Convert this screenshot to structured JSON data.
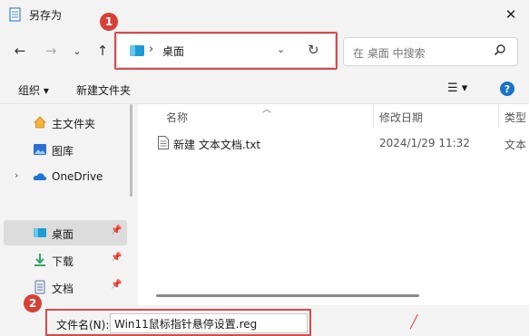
{
  "window": {
    "title": "另存为"
  },
  "nav": {
    "back_icon": "arrow-left-icon",
    "forward_icon": "arrow-right-icon",
    "recent_icon": "chevron-down-icon",
    "up_icon": "arrow-up-icon",
    "address_folder": "桌面",
    "search_placeholder": "在 桌面 中搜索"
  },
  "badges": {
    "b1": "1",
    "b2": "2"
  },
  "toolbar": {
    "organize": "组织 ▾",
    "new_folder": "新建文件夹",
    "help": "?"
  },
  "sidebar": {
    "items": [
      {
        "label": "主文件夹",
        "icon": "home-icon"
      },
      {
        "label": "图库",
        "icon": "gallery-icon"
      },
      {
        "label": "OneDrive",
        "icon": "cloud-icon"
      },
      {
        "label": "桌面",
        "icon": "desktop-icon",
        "pinned": true,
        "active": true
      },
      {
        "label": "下载",
        "icon": "download-icon",
        "pinned": true
      },
      {
        "label": "文档",
        "icon": "document-icon",
        "pinned": true
      }
    ]
  },
  "columns": {
    "name": "名称",
    "date": "修改日期",
    "type": "类型"
  },
  "files": [
    {
      "name": "新建 文本文档.txt",
      "date": "2024/1/29 11:32",
      "type": "文本"
    }
  ],
  "save": {
    "filename_label": "文件名(N):",
    "filename_value": "Win11鼠标指针悬停设置.reg"
  },
  "colors": {
    "accent": "#1a73c8",
    "highlight": "#d94a4a",
    "active_bg": "#dcdcdc"
  }
}
